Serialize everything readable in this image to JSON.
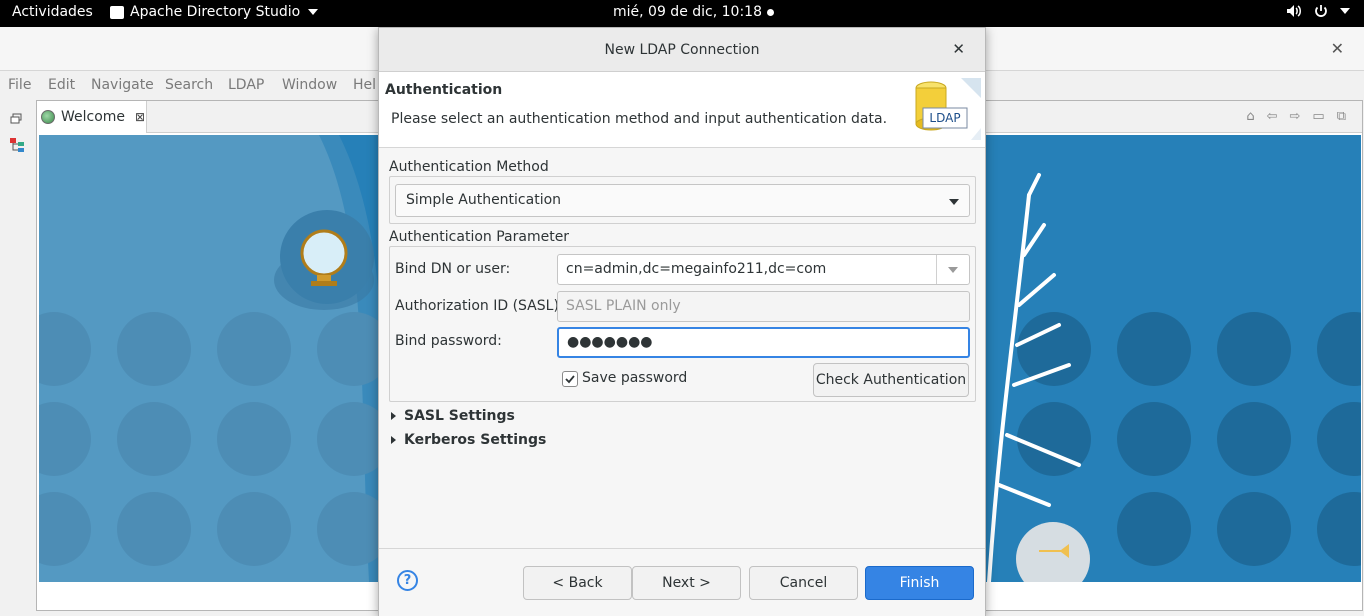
{
  "topbar": {
    "activities": "Actividades",
    "app_name": "Apache Directory Studio",
    "clock": "mié, 09 de dic, 10:18"
  },
  "menubar": {
    "items": [
      "File",
      "Edit",
      "Navigate",
      "Search",
      "LDAP",
      "Window",
      "Hel"
    ]
  },
  "editor": {
    "tab_label": "Welcome"
  },
  "dialog": {
    "title": "New LDAP Connection",
    "header_title": "Authentication",
    "header_desc": "Please select an authentication method and input authentication data.",
    "logo_text": "LDAP",
    "method_group": "Authentication Method",
    "method_value": "Simple Authentication",
    "param_group": "Authentication Parameter",
    "bind_dn_label": "Bind DN or user:",
    "bind_dn_value": "cn=admin,dc=megainfo211,dc=com",
    "authz_label": "Authorization ID (SASL):",
    "authz_placeholder": "SASL PLAIN only",
    "password_label": "Bind password:",
    "password_value": "●●●●●●●",
    "save_password_label": "Save password",
    "save_password_checked": true,
    "check_auth_label": "Check Authentication",
    "sasl_settings": "SASL Settings",
    "kerberos_settings": "Kerberos Settings",
    "help_label": "?",
    "back_label": "< Back",
    "next_label": "Next >",
    "cancel_label": "Cancel",
    "finish_label": "Finish"
  },
  "colors": {
    "accent": "#3584e4",
    "welcome_bg": "#5a9ec6",
    "welcome_dark": "#1f6fa0"
  }
}
